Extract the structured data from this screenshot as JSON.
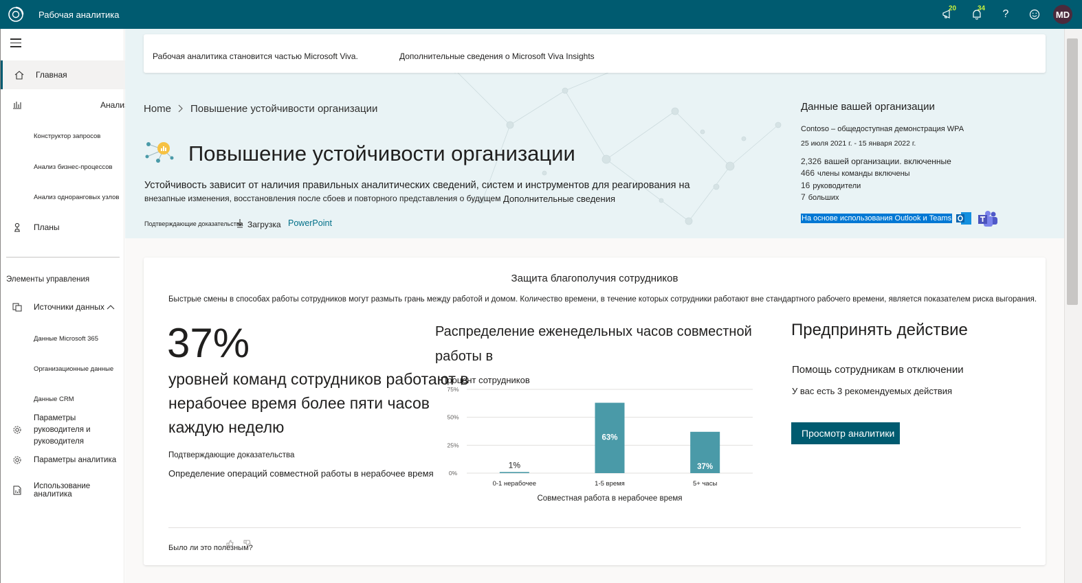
{
  "app": {
    "title": "Рабочая аналитика"
  },
  "topbar": {
    "megaphone_badge": "20",
    "bell_badge": "34",
    "help_label": "?",
    "avatar_initials": "MD"
  },
  "sidebar": {
    "home": "Главная",
    "analysis": "Анализ",
    "query_builder": "Конструктор запросов",
    "business_process": "Анализ бизнес-процессов",
    "peer_analysis": "Анализ одноранговых узлов",
    "plans": "Планы",
    "section_title": "Элементы управления",
    "data_sources": "Источники данных",
    "m365_data": "Данные Microsoft 365",
    "org_data": "Организационные данные",
    "crm_data": "Данные CRM",
    "manager_settings": "Параметры руководителя и руководителя",
    "analyst_settings": "Параметры аналитика",
    "analyst_usage": "Использование аналитика"
  },
  "banner": {
    "text": "Рабочая аналитика становится частью Microsoft Viva.",
    "link": "Дополнительные сведения о Microsoft Viva Insights"
  },
  "breadcrumb": {
    "home": "Home",
    "current": "Повышение устойчивости организации"
  },
  "hero": {
    "title": "Повышение устойчивости организации",
    "desc_line1": "Устойчивость зависит от наличия правильных аналитических сведений, систем и инструментов для реагирования на",
    "desc_line2": "внезапные изменения, восстановления после сбоев и повторного представления о будущем",
    "more_link": "Дополнительные сведения",
    "evidence_label": "Подтверждающие доказательства",
    "download": "Загрузка",
    "powerpoint": "PowerPoint"
  },
  "org": {
    "title": "Данные вашей организации",
    "tenant": "Contoso – общедоступная демонстрация WPA",
    "date_range": "25 июля 2021 г. - 15 января 2022 г.",
    "employees_num": "2,326",
    "employees_label": "вашей организации. включенные",
    "team_num": "466",
    "team_label": "члены команды включены",
    "managers_num": "16",
    "managers_label": "руководители",
    "more_num": "7",
    "more_label": "больших",
    "based_on": "На основе использования Outlook и Teams"
  },
  "card": {
    "title": "Защита благополучия сотрудников",
    "description": "Быстрые смены в способах работы сотрудников могут размыть грань между работой и домом. Количество времени, в течение которых сотрудники работают вне стандартного рабочего времени, является показателем риска выгорания.",
    "big_stat": "37%",
    "stat_text": "уровней команд сотрудников работают в нерабочее время более пяти часов каждую неделю",
    "evidence": "Подтверждающие доказательства",
    "definition": "Определение операций совместной работы в нерабочее время",
    "chart_title": "Распределение еженедельных часов совместной работы в",
    "action_title": "Предпринять действие",
    "action_sub": "Помощь сотрудникам в отключении",
    "action_count": "У вас есть 3 рекомендуемых действия",
    "action_button": "Просмотр аналитики",
    "feedback": "Было ли это полезным?"
  },
  "chart_data": {
    "type": "bar",
    "ylabel": "Процент сотрудников",
    "xlabel": "Совместная работа в нерабочее время",
    "categories": [
      "0-1 нерабочее",
      "1-5 время",
      "5+ часы"
    ],
    "values": [
      1,
      63,
      37
    ],
    "value_labels": [
      "1%",
      "63%",
      "37%"
    ],
    "yticks": [
      "0%",
      "25%",
      "50%",
      "75%"
    ],
    "ylim": [
      0,
      75
    ],
    "bar_color": "#4a9aa8",
    "grid": true
  }
}
